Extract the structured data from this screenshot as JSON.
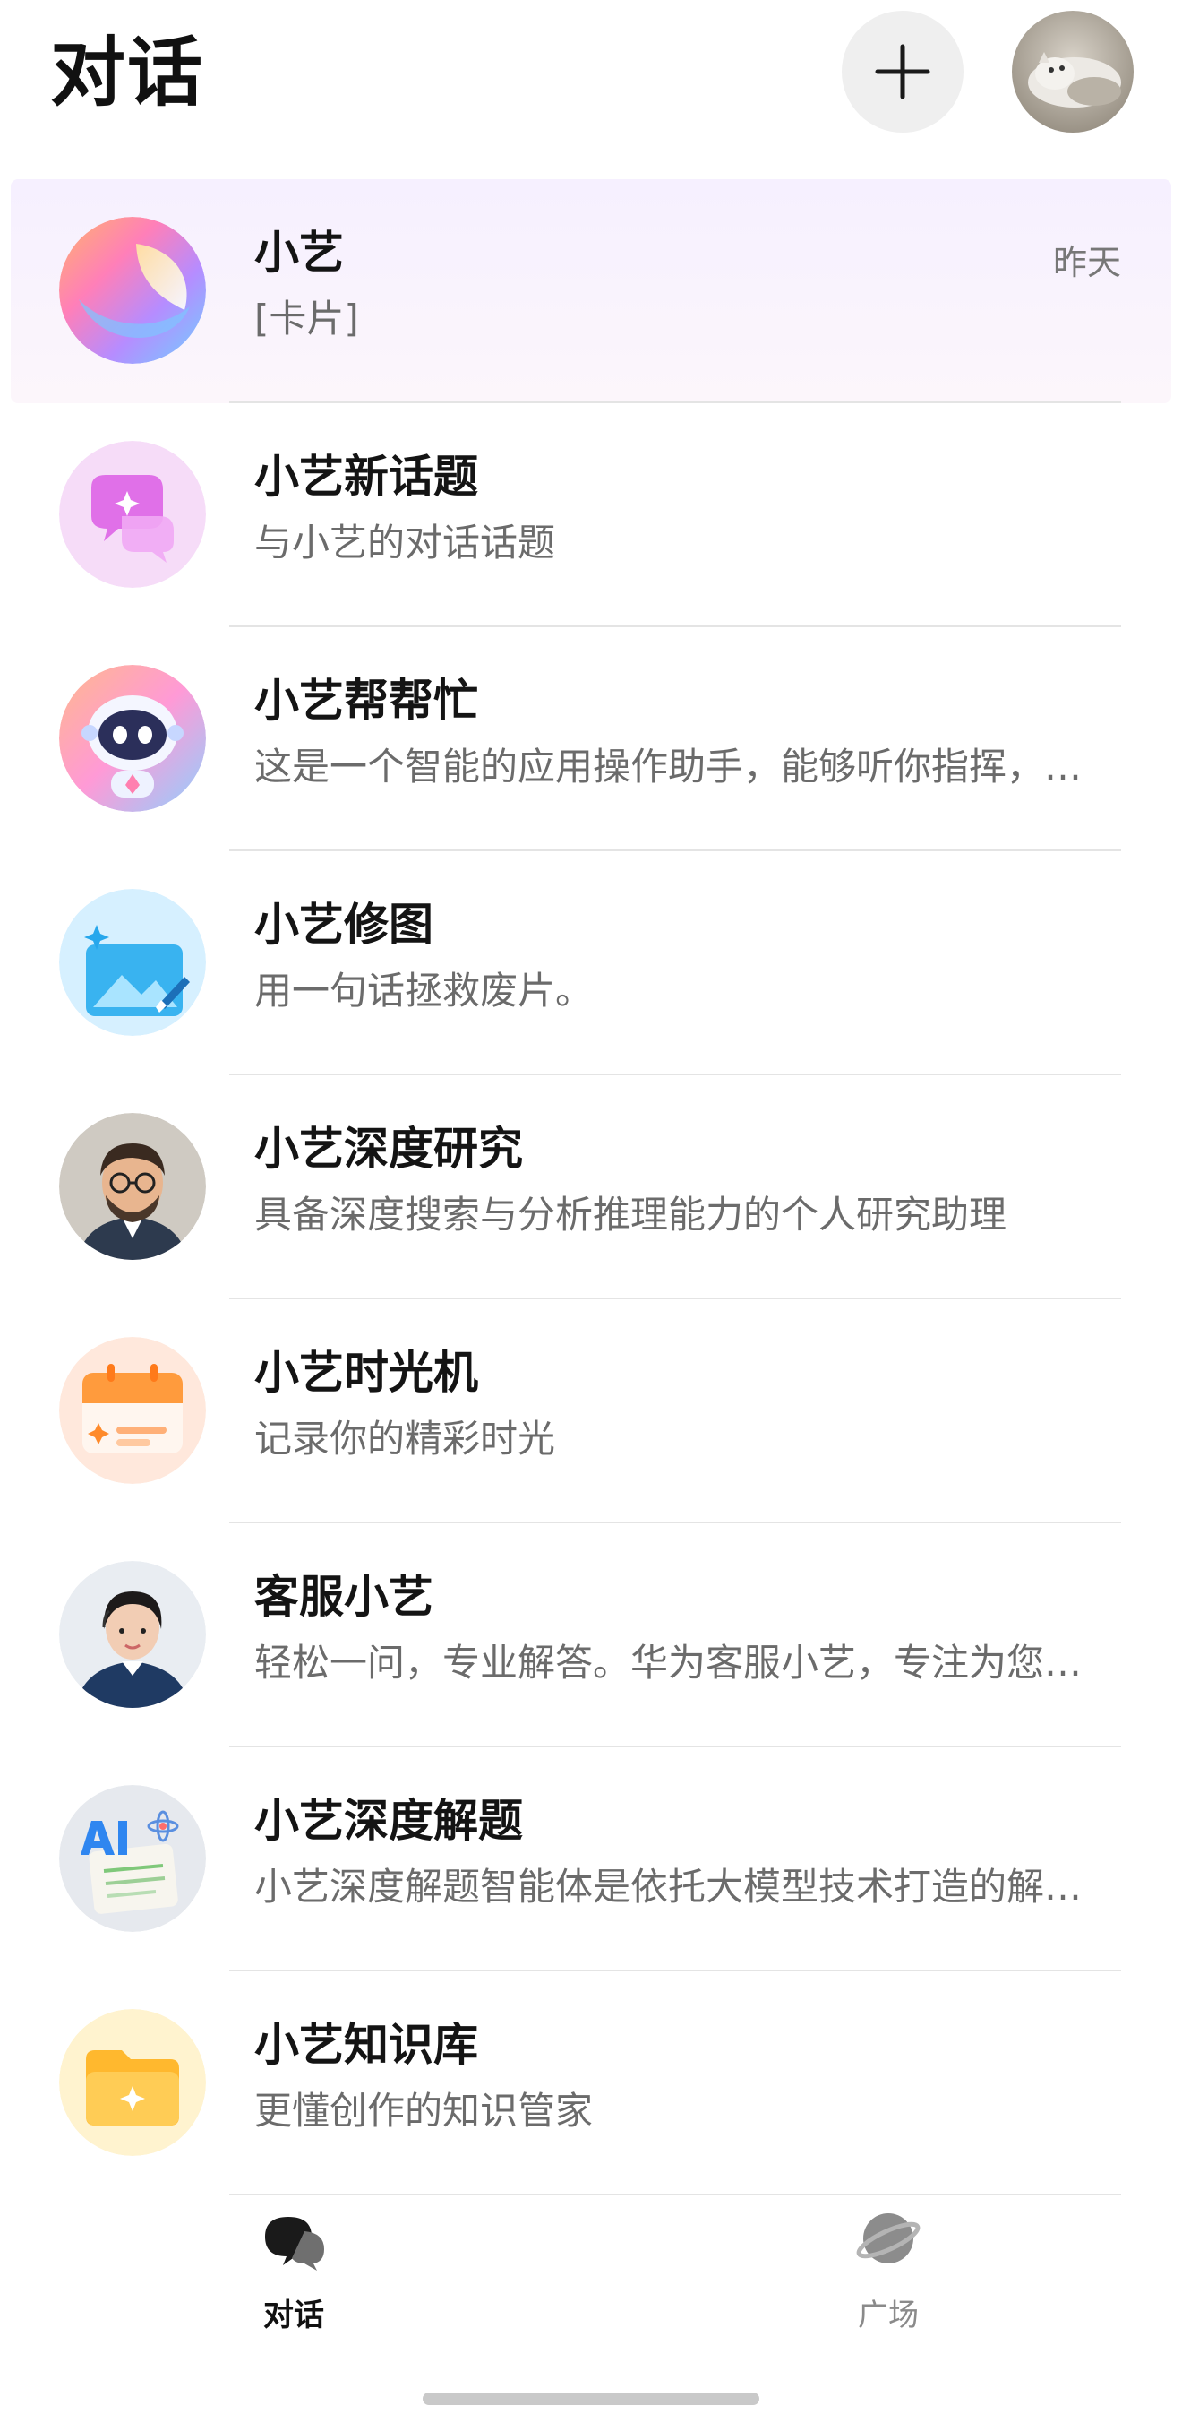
{
  "header": {
    "title": "对话",
    "add_icon": "plus-icon"
  },
  "conversations": [
    {
      "name": "小艺",
      "subtitle": "[卡片]",
      "time": "昨天",
      "pinned": true
    },
    {
      "name": "小艺新话题",
      "subtitle": "与小艺的对话话题"
    },
    {
      "name": "小艺帮帮忙",
      "subtitle": "这是一个智能的应用操作助手，能够听你指挥，帮你完成各种任务"
    },
    {
      "name": "小艺修图",
      "subtitle": "用一句话拯救废片。"
    },
    {
      "name": "小艺深度研究",
      "subtitle": "具备深度搜索与分析推理能力的个人研究助理"
    },
    {
      "name": "小艺时光机",
      "subtitle": "记录你的精彩时光"
    },
    {
      "name": "客服小艺",
      "subtitle": "轻松一问，专业解答。华为客服小艺，专注为您服务"
    },
    {
      "name": "小艺深度解题",
      "subtitle": "小艺深度解题智能体是依托大模型技术打造的解题助手"
    },
    {
      "name": "小艺知识库",
      "subtitle": "更懂创作的知识管家"
    }
  ],
  "tabbar": {
    "tabs": [
      {
        "label": "对话",
        "icon": "chat-bubbles-icon",
        "active": true
      },
      {
        "label": "广场",
        "icon": "planet-icon",
        "active": false
      }
    ]
  },
  "colors": {
    "pinned_bg": "#f6f0ff",
    "secondary_text": "#6b6b6b",
    "divider": "#e4e4e4"
  }
}
